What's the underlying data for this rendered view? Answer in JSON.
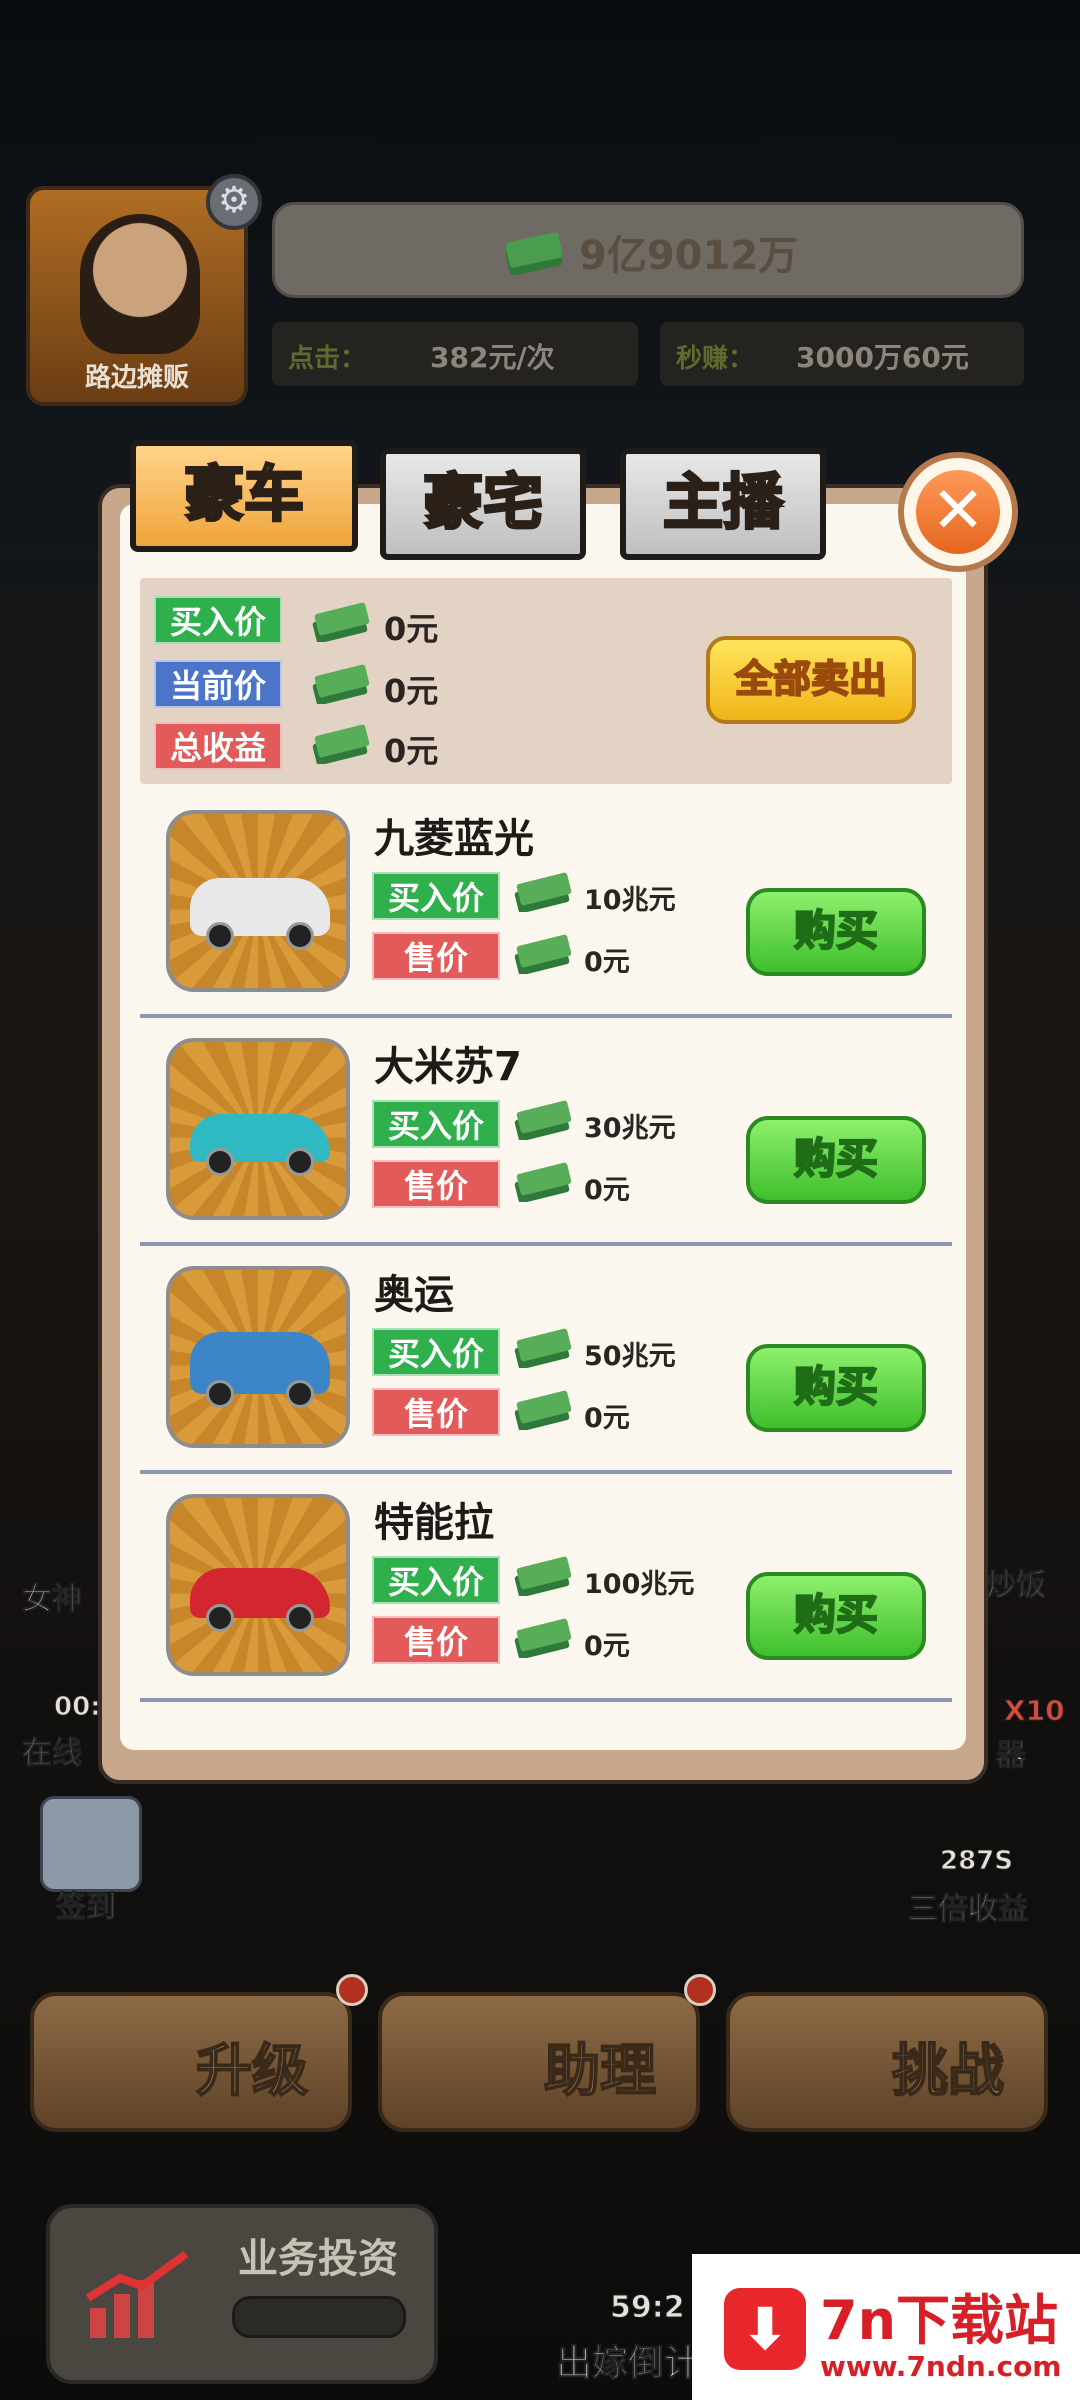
{
  "hud": {
    "avatar_label": "路边摊贩",
    "total_money": "9亿9012万",
    "click_label": "点击：",
    "click_value": "382元/次",
    "per_sec_label": "秒赚：",
    "per_sec_value": "3000万60元"
  },
  "tabs": [
    {
      "label": "豪车",
      "active": true
    },
    {
      "label": "豪宅",
      "active": false
    },
    {
      "label": "主播",
      "active": false
    }
  ],
  "summary": {
    "buy_price_label": "买入价",
    "buy_price_value": "0元",
    "current_price_label": "当前价",
    "current_price_value": "0元",
    "total_profit_label": "总收益",
    "total_profit_value": "0元",
    "sell_all_label": "全部卖出"
  },
  "cars": [
    {
      "name": "九菱蓝光",
      "buy_label": "买入价",
      "buy_price": "10兆元",
      "sell_label": "售价",
      "sell_price": "0元",
      "button": "购买",
      "color": "#e8e8e8"
    },
    {
      "name": "大米苏7",
      "buy_label": "买入价",
      "buy_price": "30兆元",
      "sell_label": "售价",
      "sell_price": "0元",
      "button": "购买",
      "color": "#2fb9c2"
    },
    {
      "name": "奥运",
      "buy_label": "买入价",
      "buy_price": "50兆元",
      "sell_label": "售价",
      "sell_price": "0元",
      "button": "购买",
      "color": "#3c86c8"
    },
    {
      "name": "特能拉",
      "buy_label": "买入价",
      "buy_price": "100兆元",
      "sell_label": "售价",
      "sell_price": "0元",
      "button": "购买",
      "color": "#d32630"
    }
  ],
  "side": {
    "left_item1": "女神",
    "left_item2_time": "00:",
    "left_item2": "在线",
    "checkin": "签到",
    "right_item1": "炒饭",
    "right_badge": "X10",
    "right_item2": "器",
    "triple_timer": "287S",
    "triple": "三倍收益"
  },
  "bottom": {
    "upgrade": "升级",
    "assistant": "助理",
    "challenge": "挑战",
    "invest": "业务投资",
    "countdown_time": "59:2",
    "countdown": "出嫁倒计"
  },
  "watermark": {
    "logo": "⬇",
    "main": "7n下载站",
    "url": "www.7ndn.com"
  },
  "colors": {
    "buy_green": "#2fb04d",
    "current_blue": "#4c74c9",
    "profit_red": "#e35a5a",
    "tab_active": "#f0a43b",
    "buy_button": "#3fbf2d"
  }
}
